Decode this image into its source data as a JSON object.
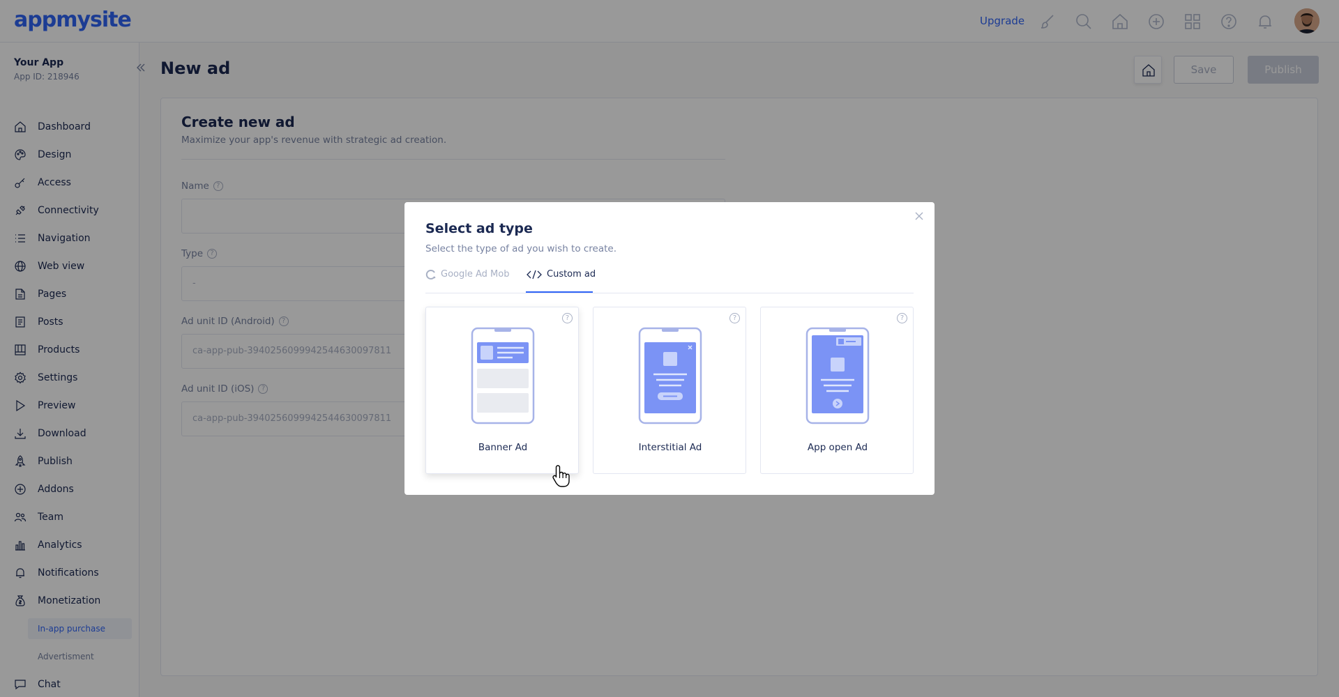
{
  "topbar": {
    "logo": "appmysite",
    "upgrade_label": "Upgrade",
    "icons": [
      "brush-icon",
      "search-icon",
      "home-icon",
      "plus-circle-icon",
      "grid-icon",
      "help-icon",
      "bell-icon"
    ]
  },
  "sidebar": {
    "app_name": "Your App",
    "app_id": "App ID: 218946",
    "items": [
      {
        "label": "Dashboard",
        "icon": "home-icon"
      },
      {
        "label": "Design",
        "icon": "palette-icon"
      },
      {
        "label": "Access",
        "icon": "key-icon"
      },
      {
        "label": "Connectivity",
        "icon": "plug-icon"
      },
      {
        "label": "Navigation",
        "icon": "list-icon"
      },
      {
        "label": "Web view",
        "icon": "globe-icon"
      },
      {
        "label": "Pages",
        "icon": "page-icon"
      },
      {
        "label": "Posts",
        "icon": "posts-icon"
      },
      {
        "label": "Products",
        "icon": "products-icon"
      },
      {
        "label": "Settings",
        "icon": "gear-icon"
      },
      {
        "label": "Preview",
        "icon": "play-icon"
      },
      {
        "label": "Download",
        "icon": "download-icon"
      },
      {
        "label": "Publish",
        "icon": "rocket-icon"
      },
      {
        "label": "Addons",
        "icon": "plus-circle-icon"
      },
      {
        "label": "Team",
        "icon": "team-icon"
      },
      {
        "label": "Analytics",
        "icon": "bar-chart-icon"
      },
      {
        "label": "Notifications",
        "icon": "bell-icon"
      },
      {
        "label": "Monetization",
        "icon": "money-bag-icon"
      }
    ],
    "sub_items": [
      {
        "label": "In-app purchase",
        "active": true
      },
      {
        "label": "Advertisment",
        "active": false
      }
    ],
    "chat": {
      "label": "Chat",
      "icon": "chat-icon"
    }
  },
  "page": {
    "title": "New ad",
    "save_label": "Save",
    "publish_label": "Publish"
  },
  "form": {
    "title": "Create new ad",
    "subtitle": "Maximize your app's revenue with strategic ad creation.",
    "name_label": "Name",
    "name_value": "",
    "type_label": "Type",
    "type_value": "-",
    "android_label": "Ad unit ID (Android)",
    "android_placeholder": "ca-app-pub-3940256099942544630097811",
    "ios_label": "Ad unit ID (iOS)",
    "ios_placeholder": "ca-app-pub-3940256099942544630097811"
  },
  "modal": {
    "title": "Select ad type",
    "subtitle": "Select the type of ad you wish to create.",
    "tabs": [
      {
        "label": "Google Ad Mob",
        "icon": "admob-icon",
        "active": false
      },
      {
        "label": "Custom ad",
        "icon": "code-icon",
        "active": true
      }
    ],
    "cards": [
      {
        "label": "Banner Ad",
        "illustration": "banner-ad-illustration"
      },
      {
        "label": "Interstitial Ad",
        "illustration": "interstitial-ad-illustration"
      },
      {
        "label": "App open Ad",
        "illustration": "app-open-ad-illustration"
      }
    ]
  },
  "colors": {
    "accent": "#3064f6",
    "text_primary": "#1b2952",
    "text_secondary": "#7782a1",
    "illustration_fill": "#7b93f5"
  }
}
